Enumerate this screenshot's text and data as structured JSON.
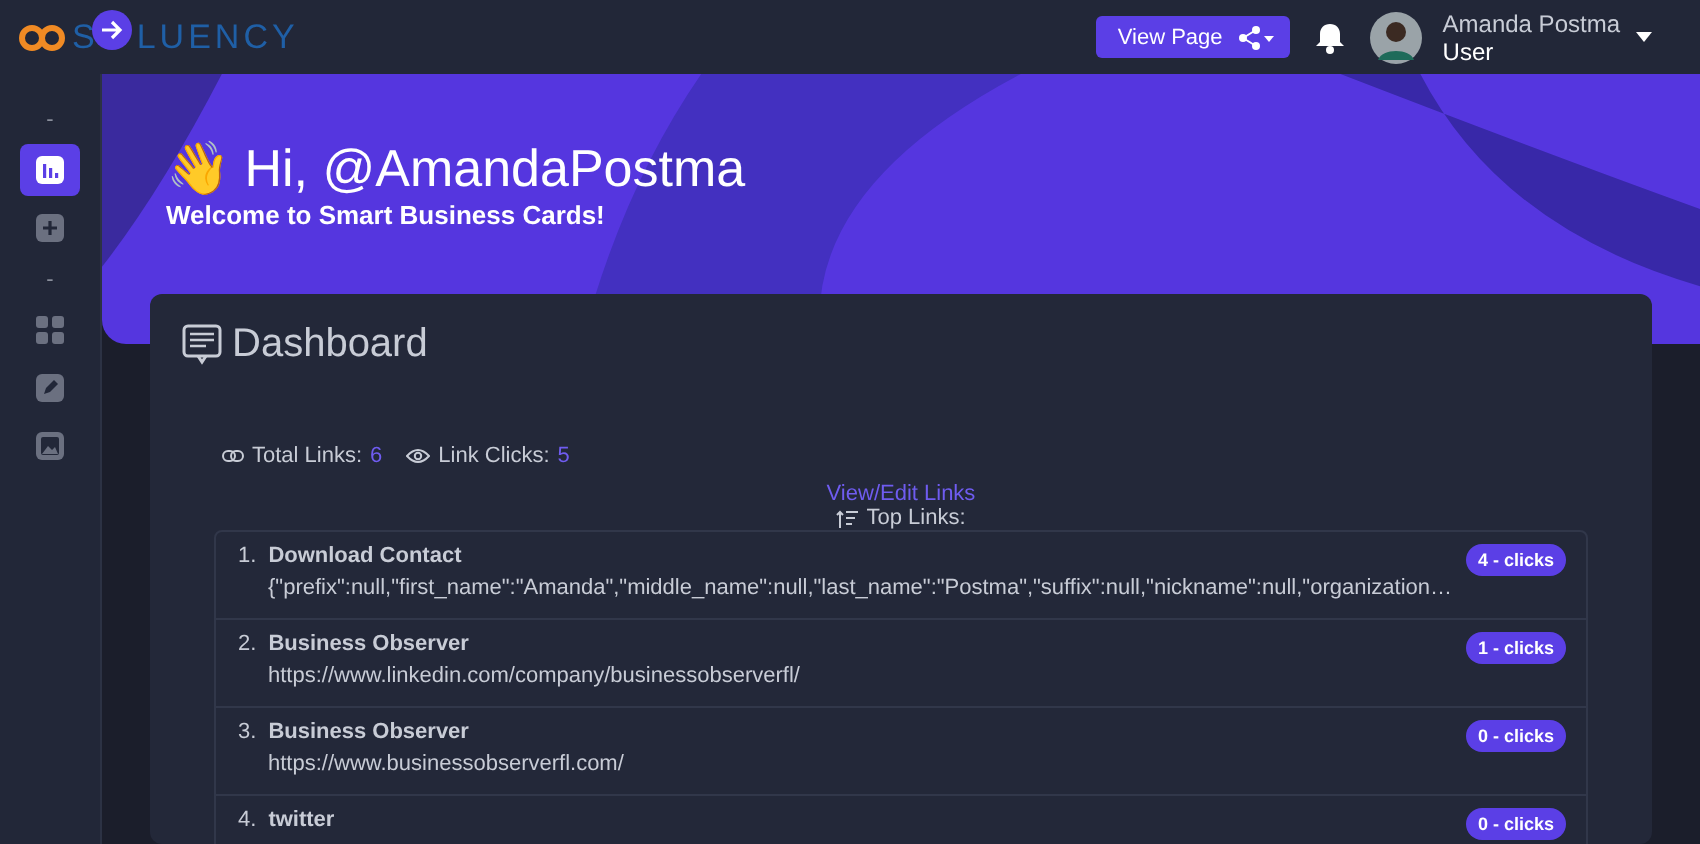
{
  "brand": {
    "text_start": "S",
    "text_end": "LUENCY"
  },
  "topbar": {
    "view_page": "View Page",
    "user_name": "Amanda Postma",
    "user_role": "User"
  },
  "sidebar": {
    "items": [
      {
        "kind": "separator",
        "label": "-"
      },
      {
        "kind": "chart",
        "selected": true
      },
      {
        "kind": "plus",
        "selected": false
      },
      {
        "kind": "separator",
        "label": "-"
      },
      {
        "kind": "grid",
        "selected": false
      },
      {
        "kind": "pencil",
        "selected": false
      },
      {
        "kind": "image",
        "selected": false
      }
    ]
  },
  "hero": {
    "wave": "👋",
    "greeting": "Hi, @AmandaPostma",
    "subtitle": "Welcome to Smart Business Cards!"
  },
  "dashboard": {
    "title": "Dashboard",
    "total_links_label": "Total Links:",
    "total_links": "6",
    "link_clicks_label": "Link Clicks:",
    "link_clicks": "5",
    "edit_link": "View/Edit Links",
    "top_links_label": "Top Links:",
    "links": [
      {
        "number": "1.",
        "title": "Download Contact",
        "url": "{\"prefix\":null,\"first_name\":\"Amanda\",\"middle_name\":null,\"last_name\":\"Postma\",\"suffix\":null,\"nickname\":null,\"organization…",
        "clicks": "4 - clicks"
      },
      {
        "number": "2.",
        "title": "Business Observer",
        "url": "https://www.linkedin.com/company/businessobserverfl/",
        "clicks": "1 - clicks"
      },
      {
        "number": "3.",
        "title": "Business Observer",
        "url": "https://www.businessobserverfl.com/",
        "clicks": "0 - clicks"
      },
      {
        "number": "4.",
        "title": "twitter",
        "clicks": "0 - clicks"
      }
    ]
  }
}
